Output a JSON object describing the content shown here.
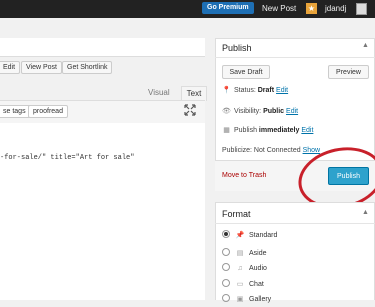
{
  "adminbar": {
    "go_premium": "Go Premium",
    "new_post": "New Post",
    "notification_icon": "star-icon",
    "username": "jdandj"
  },
  "editor": {
    "buttons": [
      "Edit",
      "View Post",
      "Get Shortlink"
    ],
    "tabs": {
      "visual": "Visual",
      "text": "Text"
    },
    "quicktags": [
      "se tags",
      "proofread"
    ],
    "code_line": "-for-sale/\" title=\"Art for sale\""
  },
  "publish": {
    "title": "Publish",
    "save_draft": "Save Draft",
    "preview": "Preview",
    "status_label": "Status:",
    "status_value": "Draft",
    "visibility_label": "Visibility:",
    "visibility_value": "Public",
    "publish_label": "Publish",
    "publish_value": "immediately",
    "edit": "Edit",
    "publicize": "Publicize: Not Connected",
    "show": "Show",
    "trash": "Move to Trash",
    "publish_button": "Publish",
    "colors": {
      "primary": "#2ea2cc",
      "annotation": "#c8202a"
    }
  },
  "format": {
    "title": "Format",
    "options": [
      {
        "label": "Standard",
        "icon": "pin-icon",
        "selected": true
      },
      {
        "label": "Aside",
        "icon": "document-icon",
        "selected": false
      },
      {
        "label": "Audio",
        "icon": "music-icon",
        "selected": false
      },
      {
        "label": "Chat",
        "icon": "chat-icon",
        "selected": false
      },
      {
        "label": "Gallery",
        "icon": "gallery-icon",
        "selected": false
      }
    ]
  }
}
